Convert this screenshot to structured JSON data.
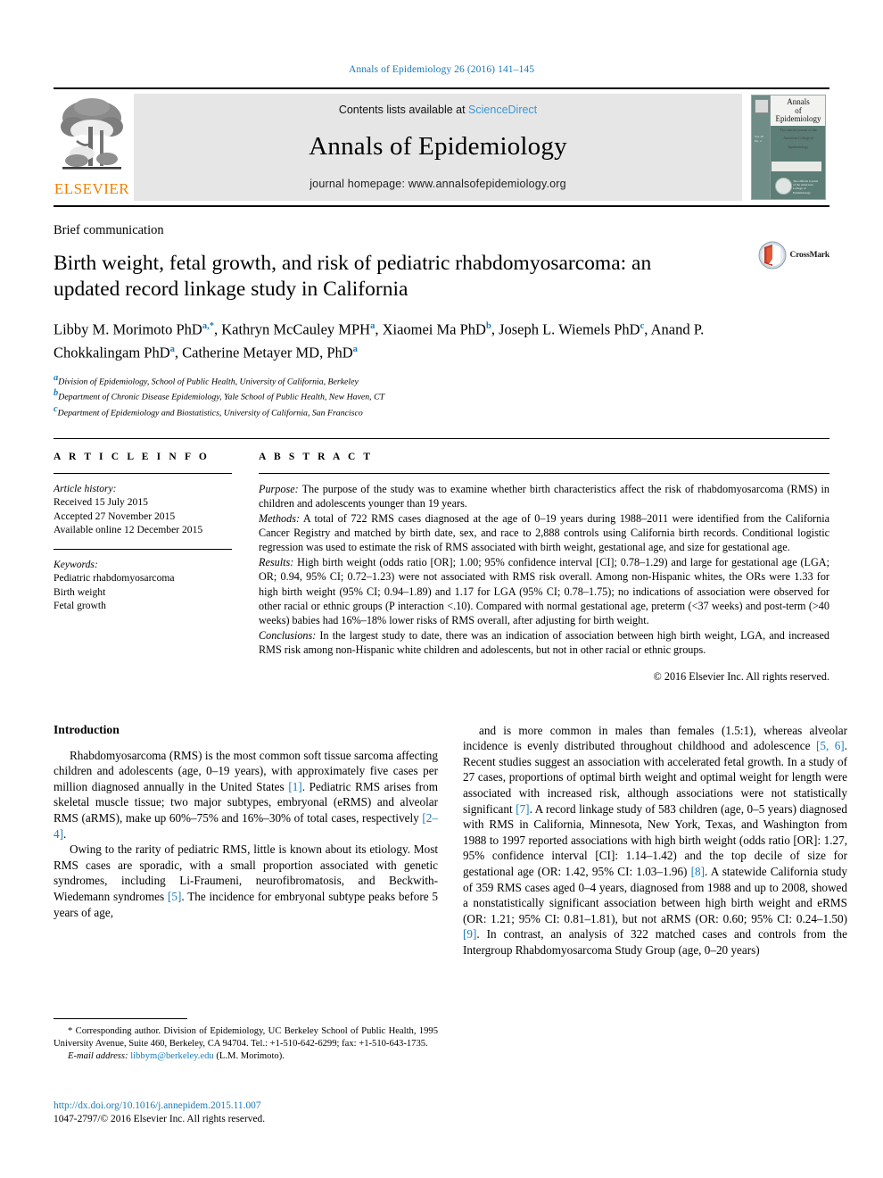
{
  "running_head": "Annals of Epidemiology 26 (2016) 141–145",
  "masthead": {
    "publisher": "ELSEVIER",
    "publisher_logo": "elsevier-tree-logo",
    "contents_prefix": "Contents lists available at ",
    "contents_link": "ScienceDirect",
    "journal_title": "Annals of Epidemiology",
    "homepage": "journal homepage: www.annalsofepidemiology.org",
    "cover": {
      "line1": "Annals",
      "line2": "of",
      "line3": "Epidemiology",
      "subtitle": "The official journal of the American College of Epidemiology",
      "seal_text": "The Official Journal of the American College of Epidemiology",
      "color": "#5d7d77"
    }
  },
  "article": {
    "doctype": "Brief communication",
    "title": "Birth weight, fetal growth, and risk of pediatric rhabdomyosarcoma: an updated record linkage study in California",
    "crossmark_label": "CrossMark",
    "authors_html": "Libby M. Morimoto PhD<sup>a</sup><sup>,</sup><sup>*</sup>, Kathryn McCauley MPH<sup>a</sup>, Xiaomei Ma PhD<sup>b</sup>, Joseph L. Wiemels PhD<sup>c</sup>, Anand P. Chokkalingam PhD<sup>a</sup>, Catherine Metayer MD, PhD<sup>a</sup>",
    "affiliations": [
      {
        "marker": "a",
        "text": "Division of Epidemiology, School of Public Health, University of California, Berkeley"
      },
      {
        "marker": "b",
        "text": "Department of Chronic Disease Epidemiology, Yale School of Public Health, New Haven, CT"
      },
      {
        "marker": "c",
        "text": "Department of Epidemiology and Biostatistics, University of California, San Francisco"
      }
    ]
  },
  "article_info": {
    "heading": "A R T I C L E   I N F O",
    "history_label": "Article history:",
    "history": [
      "Received 15 July 2015",
      "Accepted 27 November 2015",
      "Available online 12 December 2015"
    ],
    "keywords_label": "Keywords:",
    "keywords": [
      "Pediatric rhabdomyosarcoma",
      "Birth weight",
      "Fetal growth"
    ]
  },
  "abstract": {
    "heading": "A B S T R A C T",
    "purpose_label": "Purpose:",
    "purpose_text": " The purpose of the study was to examine whether birth characteristics affect the risk of rhabdomyosarcoma (RMS) in children and adolescents younger than 19 years.",
    "methods_label": "Methods:",
    "methods_text": " A total of 722 RMS cases diagnosed at the age of 0–19 years during 1988–2011 were identified from the California Cancer Registry and matched by birth date, sex, and race to 2,888 controls using California birth records. Conditional logistic regression was used to estimate the risk of RMS associated with birth weight, gestational age, and size for gestational age.",
    "results_label": "Results:",
    "results_text": " High birth weight (odds ratio [OR]; 1.00; 95% confidence interval [CI]; 0.78–1.29) and large for gestational age (LGA; OR; 0.94, 95% CI; 0.72–1.23) were not associated with RMS risk overall. Among non-Hispanic whites, the ORs were 1.33 for high birth weight (95% CI; 0.94–1.89) and 1.17 for LGA (95% CI; 0.78–1.75); no indications of association were observed for other racial or ethnic groups (P interaction <.10). Compared with normal gestational age, preterm (<37 weeks) and post-term (>40 weeks) babies had 16%–18% lower risks of RMS overall, after adjusting for birth weight.",
    "conclusions_label": "Conclusions:",
    "conclusions_text": " In the largest study to date, there was an indication of association between high birth weight, LGA, and increased RMS risk among non-Hispanic white children and adolescents, but not in other racial or ethnic groups.",
    "copyright": "© 2016 Elsevier Inc. All rights reserved."
  },
  "body": {
    "intro_heading": "Introduction",
    "left_paragraphs": [
      {
        "segments": [
          {
            "t": "Rhabdomyosarcoma (RMS) is the most common soft tissue sarcoma affecting children and adolescents (age, 0–19 years), with approximately five cases per million diagnosed annually in the United States ",
            "ref": false
          },
          {
            "t": "[1]",
            "ref": true
          },
          {
            "t": ". Pediatric RMS arises from skeletal muscle tissue; two major subtypes, embryonal (eRMS) and alveolar RMS (aRMS), make up 60%–75% and 16%–30% of total cases, respectively ",
            "ref": false
          },
          {
            "t": "[2–4]",
            "ref": true
          },
          {
            "t": ".",
            "ref": false
          }
        ]
      },
      {
        "segments": [
          {
            "t": "Owing to the rarity of pediatric RMS, little is known about its etiology. Most RMS cases are sporadic, with a small proportion associated with genetic syndromes, including Li-Fraumeni, neurofibromatosis, and Beckwith-Wiedemann syndromes ",
            "ref": false
          },
          {
            "t": "[5]",
            "ref": true
          },
          {
            "t": ". The incidence for embryonal subtype peaks before 5 years of age,",
            "ref": false
          }
        ]
      }
    ],
    "right_paragraphs": [
      {
        "segments": [
          {
            "t": "and is more common in males than females (1.5:1), whereas alveolar incidence is evenly distributed throughout childhood and adolescence ",
            "ref": false
          },
          {
            "t": "[5, 6]",
            "ref": true
          },
          {
            "t": ". Recent studies suggest an association with accelerated fetal growth. In a study of 27 cases, proportions of optimal birth weight and optimal weight for length were associated with increased risk, although associations were not statistically significant ",
            "ref": false
          },
          {
            "t": "[7]",
            "ref": true
          },
          {
            "t": ". A record linkage study of 583 children (age, 0–5 years) diagnosed with RMS in California, Minnesota, New York, Texas, and Washington from 1988 to 1997 reported associations with high birth weight (odds ratio [OR]: 1.27, 95% confidence interval [CI]: 1.14–1.42) and the top decile of size for gestational age (OR: 1.42, 95% CI: 1.03–1.96) ",
            "ref": false
          },
          {
            "t": "[8]",
            "ref": true
          },
          {
            "t": ". A statewide California study of 359 RMS cases aged 0–4 years, diagnosed from 1988 and up to 2008, showed a nonstatistically significant association between high birth weight and eRMS (OR: 1.21; 95% CI: 0.81–1.81), but not aRMS (OR: 0.60; 95% CI: 0.24–1.50) ",
            "ref": false
          },
          {
            "t": "[9]",
            "ref": true
          },
          {
            "t": ". In contrast, an analysis of 322 matched cases and controls from the Intergroup Rhabdomyosarcoma Study Group (age, 0–20 years)",
            "ref": false
          }
        ]
      }
    ]
  },
  "footnotes": {
    "corresponding": "* Corresponding author. Division of Epidemiology, UC Berkeley School of Public Health, 1995 University Avenue, Suite 460, Berkeley, CA 94704. Tel.: +1-510-642-6299; fax: +1-510-643-1735.",
    "email_label": "E-mail address:",
    "email": "libbym@berkeley.edu",
    "email_suffix": " (L.M. Morimoto).",
    "doi": "http://dx.doi.org/10.1016/j.annepidem.2015.11.007",
    "issn_line": "1047-2797/© 2016 Elsevier Inc. All rights reserved."
  },
  "colors": {
    "link_blue": "#1a7bb9",
    "sciencedirect_blue": "#3f97d3",
    "elsevier_orange": "#F08000",
    "cover_teal": "#5d7d77"
  }
}
